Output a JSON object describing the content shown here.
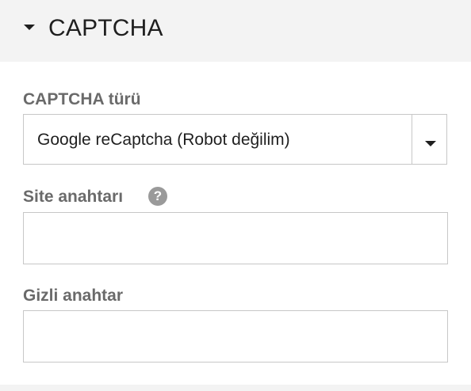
{
  "section": {
    "title": "CAPTCHA",
    "toggle_icon": "caret-down-icon"
  },
  "fields": {
    "captcha_type": {
      "label": "CAPTCHA türü",
      "selected_value": "Google reCaptcha (Robot değilim)",
      "arrow_icon": "chevron-down-icon"
    },
    "site_key": {
      "label": "Site anahtarı",
      "help_icon": "question-circle-icon",
      "help_glyph": "?",
      "value": "",
      "placeholder": ""
    },
    "secret_key": {
      "label": "Gizli anahtar",
      "value": "",
      "placeholder": ""
    }
  },
  "colors": {
    "header_background": "#f3f3f3",
    "label_text": "#6a6a6a",
    "border": "#c7c7c7",
    "help_icon": "#9a9a9a"
  }
}
